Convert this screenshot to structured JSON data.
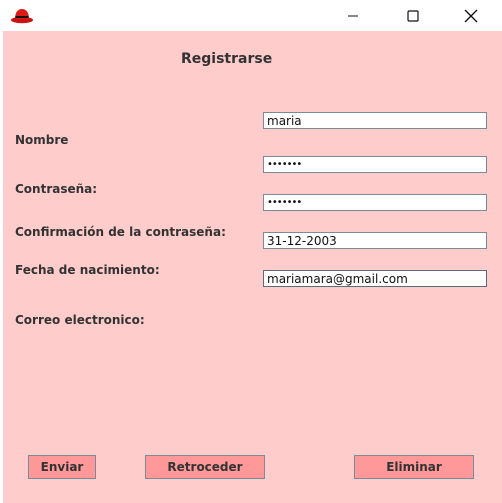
{
  "window": {
    "app_icon": "red-fedora-icon",
    "controls": [
      "minimize-icon",
      "maximize-icon",
      "close-icon"
    ]
  },
  "form": {
    "title": "Registrarse",
    "labels": {
      "nombre": "Nombre",
      "contrasena": "Contraseña:",
      "confirmacion": "Confirmación de la contraseña:",
      "fecha": "Fecha de nacimiento:",
      "correo": "Correo electronico:"
    },
    "fields": {
      "nombre": "maria",
      "contrasena": "•••••••",
      "confirmacion": "•••••••",
      "fecha": "31-12-2003",
      "correo": "mariamara@gmail.com"
    }
  },
  "buttons": {
    "enviar": "Enviar",
    "retroceder": "Retroceder",
    "eliminar": "Eliminar"
  },
  "colors": {
    "background": "#ffcccc",
    "button": "#ff9999",
    "field_border": "#7a8a99"
  }
}
